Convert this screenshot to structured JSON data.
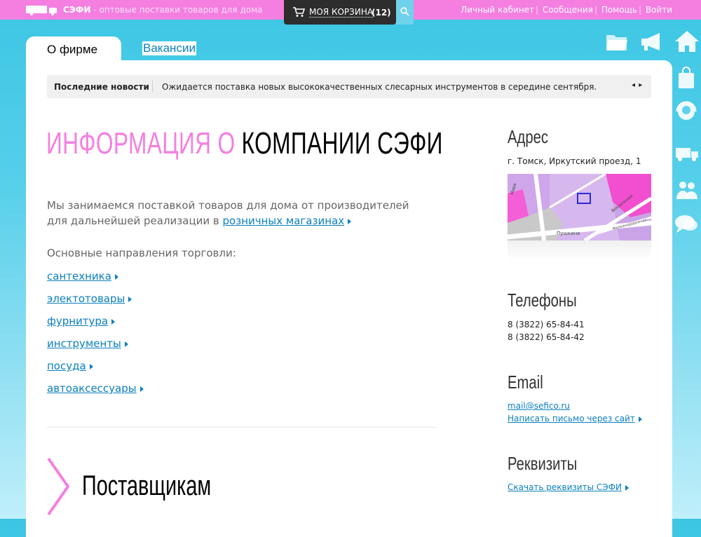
{
  "topbar": {
    "brand_name": "СЭФИ",
    "brand_tagline": " - оптовые поставки товаров для дома",
    "cart_label": "МОЯ КОРЗИНА",
    "cart_count": "(12)",
    "links": [
      "Личный кабинет",
      "Сообщения",
      "Помощь",
      "Войти"
    ],
    "separator": "|"
  },
  "tabs": [
    {
      "label": "О фирме",
      "active": true
    },
    {
      "label": "Вакансии",
      "active": false
    }
  ],
  "news": {
    "title": "Последние новости",
    "text": "Ожидается поставка новых высококачественных слесарных инструментов в середине сентября.",
    "arrows": "◂ ▸"
  },
  "main": {
    "heading_pink": "ИНФОРМАЦИЯ О ",
    "heading_black": "КОМПАНИИ СЭФИ",
    "intro_text": "Мы занимаемся поставкой товаров для дома от производителей для дальнейшей реализации в ",
    "intro_link": "розничных магазинах",
    "directions_heading": "Основные направления торговли:",
    "directions": [
      "сантехника",
      "электотовары",
      "фурнитура",
      "инструменты",
      "посуда",
      "автоаксессуары"
    ],
    "suppliers_heading": "Поставщикам"
  },
  "sidebar": {
    "address_heading": "Адрес",
    "address": "г. Томск, Иркутский проезд, 1",
    "map_labels": [
      "Мира",
      "Вокзальная",
      "Пушкина",
      "Железнодорожная"
    ],
    "phones_heading": "Телефоны",
    "phones": [
      "8 (3822) 65-84-41",
      "8 (3822) 65-84-42"
    ],
    "email_heading": "Email",
    "email": "mail@sefico.ru",
    "write_link": "Написать письмо через сайт",
    "requisites_heading": "Реквизиты",
    "requisites_link": "Скачать реквизиты СЭФИ"
  },
  "icons": {
    "top_right": [
      "folder-icon",
      "megaphone-icon",
      "home-icon"
    ],
    "right_column": [
      "shopping-bag-icon",
      "support-icon",
      "truck-icon",
      "people-icon",
      "chat-icon"
    ]
  },
  "colors": {
    "accent_pink": "#f47fe0",
    "link_blue": "#0a7fc0",
    "cart_bg": "#2d2d2d"
  }
}
